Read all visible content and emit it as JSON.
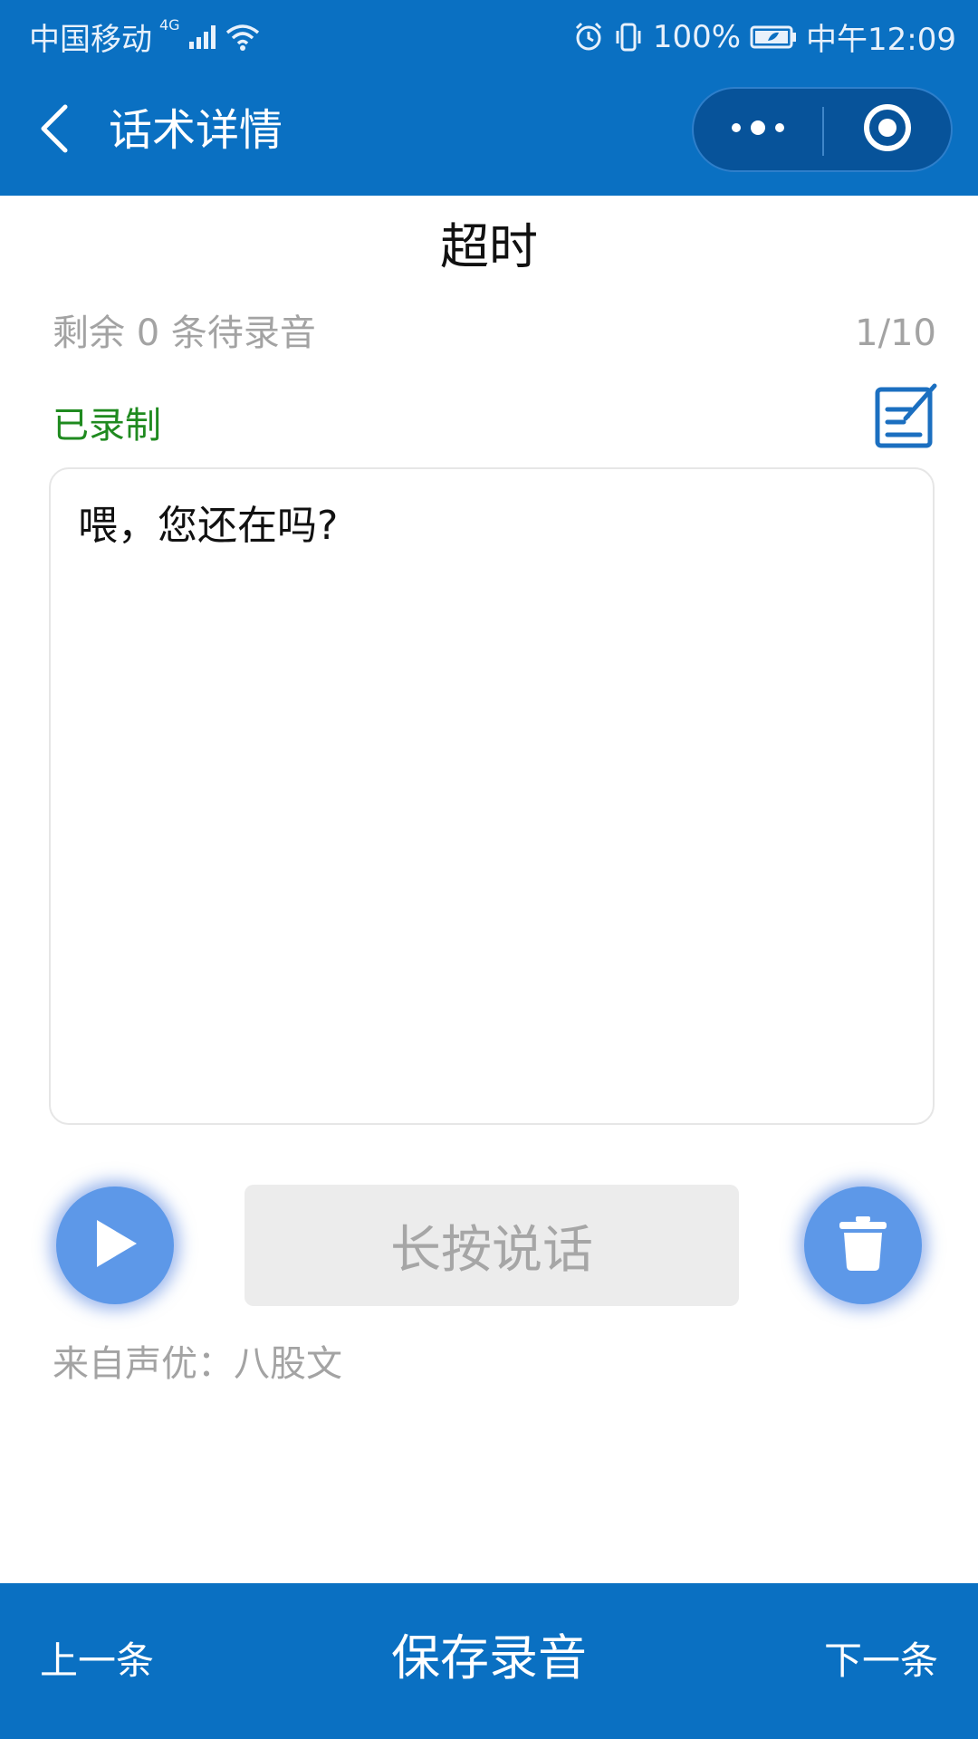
{
  "status_bar": {
    "carrier": "中国移动",
    "network": "4G",
    "battery": "100%",
    "time": "中午12:09"
  },
  "header": {
    "title": "话术详情",
    "back_icon": "chevron-left-icon",
    "more_icon": "more-dots-icon",
    "close_icon": "target-circle-icon"
  },
  "script": {
    "title": "超时",
    "remaining": "剩余 0 条待录音",
    "counter": "1/10",
    "status": "已录制",
    "text": "喂，您还在吗?"
  },
  "controls": {
    "hold_to_talk": "长按说话",
    "voice_actor": "来自声优：八股文"
  },
  "bottom_bar": {
    "prev": "上一条",
    "save": "保存录音",
    "next": "下一条"
  },
  "colors": {
    "brand_blue": "#0A70C2",
    "button_blue": "#5d98e8",
    "recorded_green": "#1f8a1f",
    "muted_text": "#a3a3a3"
  }
}
